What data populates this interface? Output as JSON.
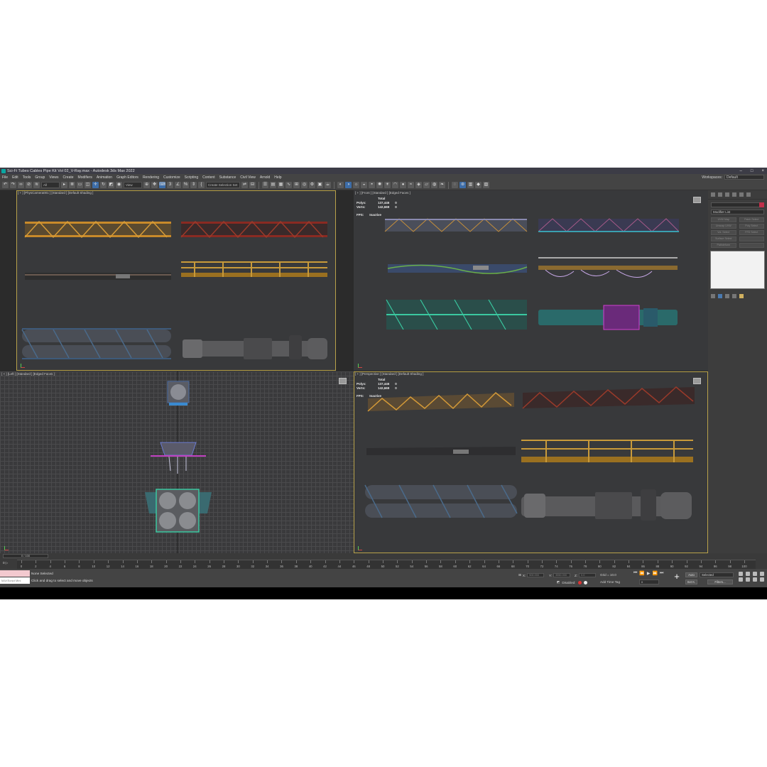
{
  "window": {
    "title": "Sci-Fi Tubes Cables Pipe Kit Vol 02_V-Ray.max - Autodesk 3ds Max 2022"
  },
  "menu": [
    "File",
    "Edit",
    "Tools",
    "Group",
    "Views",
    "Create",
    "Modifiers",
    "Animation",
    "Graph Editors",
    "Rendering",
    "Customize",
    "Scripting",
    "Content",
    "Substance",
    "Civil View",
    "Arnold",
    "Help"
  ],
  "workspaces": {
    "label": "Workspaces:",
    "value": "Default"
  },
  "toolbar": {
    "filter_value": "All",
    "view_value": "View",
    "selection_set_placeholder": "Create Selection Set"
  },
  "viewports": {
    "top_left": {
      "label": "[ + ] [PhysCamera001 ] [Standard ] [Default Shading ]"
    },
    "top_right": {
      "label": "[ + ] [Front ] [Standard ] [Edged Faces ]"
    },
    "bottom_left": {
      "label": "[ + ] [Left ] [Standard ] [Edged Faces ]"
    },
    "bottom_right": {
      "label": "[ + ] [Perspective ] [Standard ] [Default Shading ]"
    }
  },
  "stats": {
    "total": "Total",
    "polys_label": "Polys:",
    "polys": "137,446",
    "polys_sel": "0",
    "verts_label": "Verts:",
    "verts": "142,669",
    "verts_sel": "0",
    "fps_label": "FPS:",
    "fps": "Inactive"
  },
  "command_panel": {
    "modifier_list": "Modifier List",
    "buttons": [
      "UVW Map",
      "Patch Select",
      "Unwrap UVW",
      "Poly Select",
      "Vol. Select",
      "FFD Select",
      "Surface Select",
      "",
      "Pathdeform",
      ""
    ]
  },
  "timeline": {
    "slider": "0 / 100",
    "ticks": [
      "0",
      "2",
      "4",
      "6",
      "8",
      "10",
      "12",
      "14",
      "16",
      "18",
      "20",
      "22",
      "24",
      "26",
      "28",
      "30",
      "32",
      "34",
      "36",
      "38",
      "40",
      "42",
      "44",
      "46",
      "48",
      "50",
      "52",
      "54",
      "56",
      "58",
      "60",
      "62",
      "64",
      "66",
      "68",
      "70",
      "72",
      "74",
      "76",
      "78",
      "80",
      "82",
      "84",
      "86",
      "88",
      "90",
      "92",
      "94",
      "96",
      "98",
      "100"
    ],
    "key_label": "0 ▷"
  },
  "status": {
    "selection": "None Selected",
    "prompt": "Click and drag to select and move objects",
    "maxscript": "MAXScript Mini",
    "x_label": "X:",
    "y_label": "Y:",
    "z_label": "Z:",
    "x_value": "500.000",
    "y_value": "3550.000",
    "z_value": "0.0",
    "grid": "Grid = 10.0",
    "disabled": "Disabled:",
    "add_time_tag": "Add Time Tag",
    "auto": "Auto",
    "set_k": "Set K.",
    "selected": "Selected",
    "filters": "Filters...",
    "frame": "0"
  },
  "colors": {
    "accent": "#b8a24a",
    "titlebar": "#3c3c46",
    "viewport": "#38393b"
  }
}
